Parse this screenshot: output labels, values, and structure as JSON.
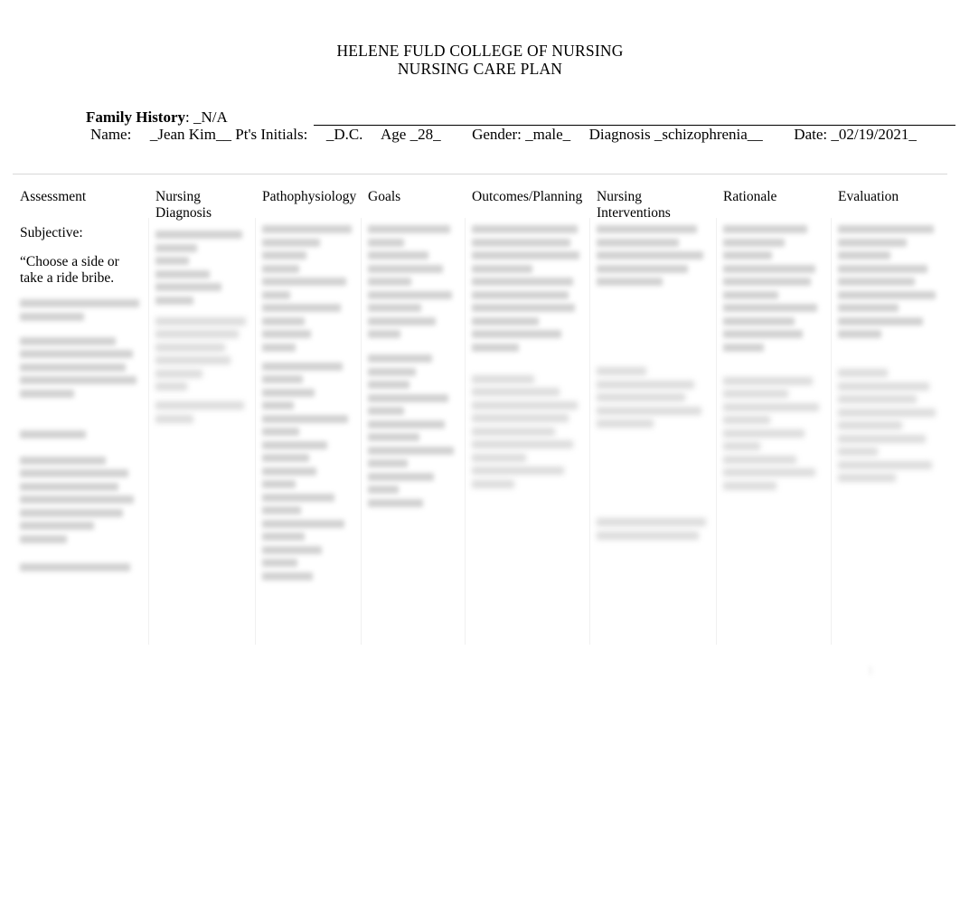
{
  "document": {
    "title_line1": "HELENE FULD COLLEGE OF NURSING",
    "title_line2": "NURSING CARE PLAN"
  },
  "header": {
    "family_history_label": "Family History",
    "family_history_sep": ": ",
    "family_history_value": "_N/A",
    "name_label": "Name:",
    "name_value": "_Jean Kim__",
    "initials_label": "Pt's Initials:",
    "initials_value": "_D.C.",
    "age_label": "Age",
    "age_value": "_28_",
    "gender_label": "Gender:",
    "gender_value": "_male_",
    "diagnosis_label": "Diagnosis",
    "diagnosis_value": "_schizophrenia__",
    "date_label": "Date:",
    "date_value": "_02/19/2021_"
  },
  "table": {
    "columns": [
      {
        "label": "Assessment"
      },
      {
        "label": "Nursing Diagnosis"
      },
      {
        "label": "Pathophysiology"
      },
      {
        "label": "Goals"
      },
      {
        "label": "Outcomes/Planning"
      },
      {
        "label": "Nursing Interventions"
      },
      {
        "label": "Rationale"
      },
      {
        "label": "Evaluation"
      }
    ],
    "assessment": {
      "subjective_label": "Subjective:",
      "subjective_quote": "“Choose a side or take a ride bribe."
    }
  },
  "footer": {
    "page_number": "1"
  }
}
